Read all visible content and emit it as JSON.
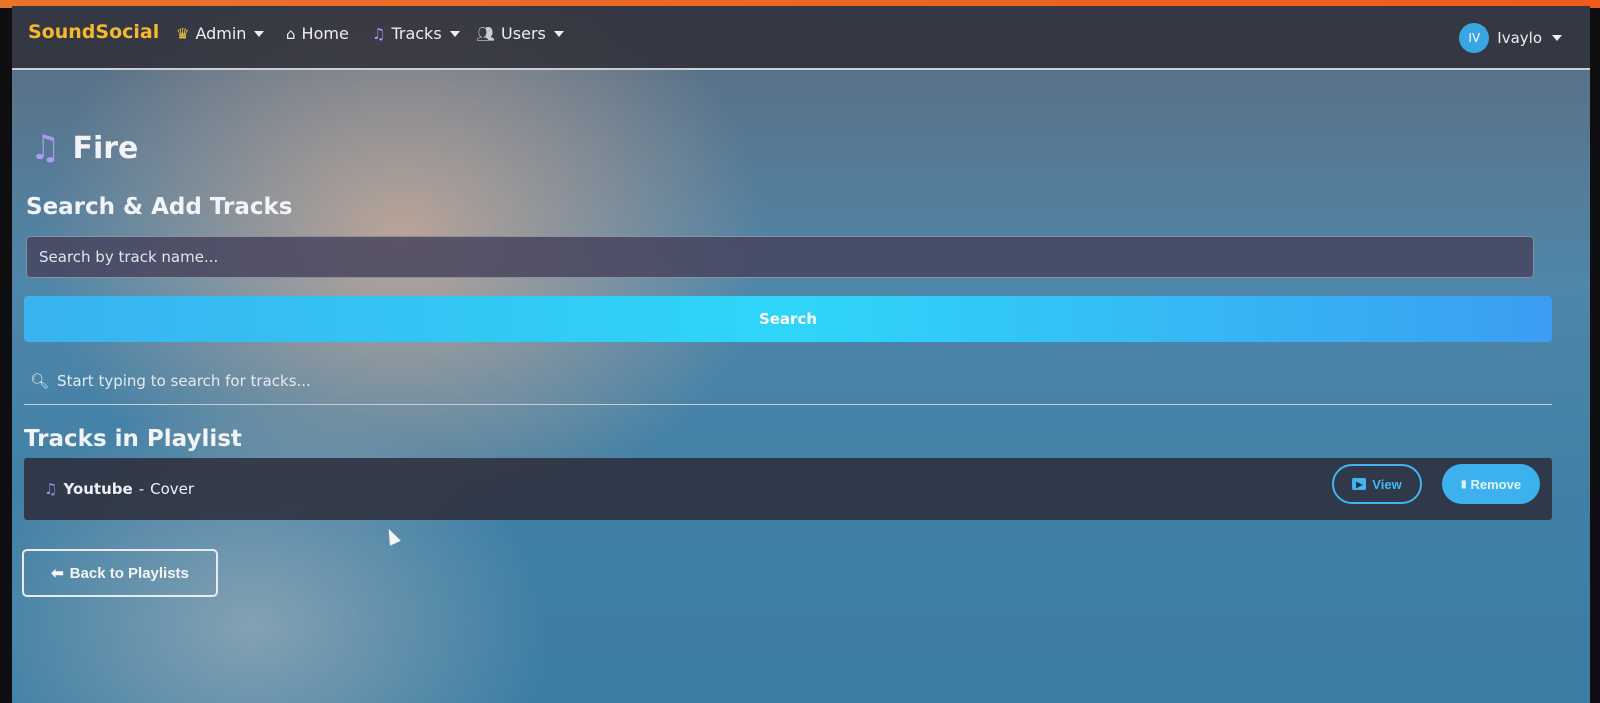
{
  "navbar": {
    "brand": "SoundSocial",
    "items": [
      {
        "label": "Admin",
        "icon": "crown-icon",
        "dropdown": true
      },
      {
        "label": "Home",
        "icon": "home-icon",
        "dropdown": false
      },
      {
        "label": "Tracks",
        "icon": "music-note-icon",
        "dropdown": true
      },
      {
        "label": "Users",
        "icon": "users-icon",
        "dropdown": true
      }
    ],
    "user": {
      "initials": "IV",
      "name": "Ivaylo"
    }
  },
  "page": {
    "title": "Fire"
  },
  "search": {
    "heading": "Search & Add Tracks",
    "placeholder": "Search by track name...",
    "button_label": "Search",
    "hint": "Start typing to search for tracks..."
  },
  "playlist": {
    "heading": "Tracks in Playlist",
    "tracks": [
      {
        "title": "Youtube",
        "artist": "Cover",
        "separator": "-",
        "view_label": "View",
        "remove_label": "Remove"
      }
    ]
  },
  "footer": {
    "back_label": "Back to Playlists"
  },
  "colors": {
    "brand": "#f7b731",
    "accent": "#39b2ef",
    "navbar": "#2c2c34"
  }
}
